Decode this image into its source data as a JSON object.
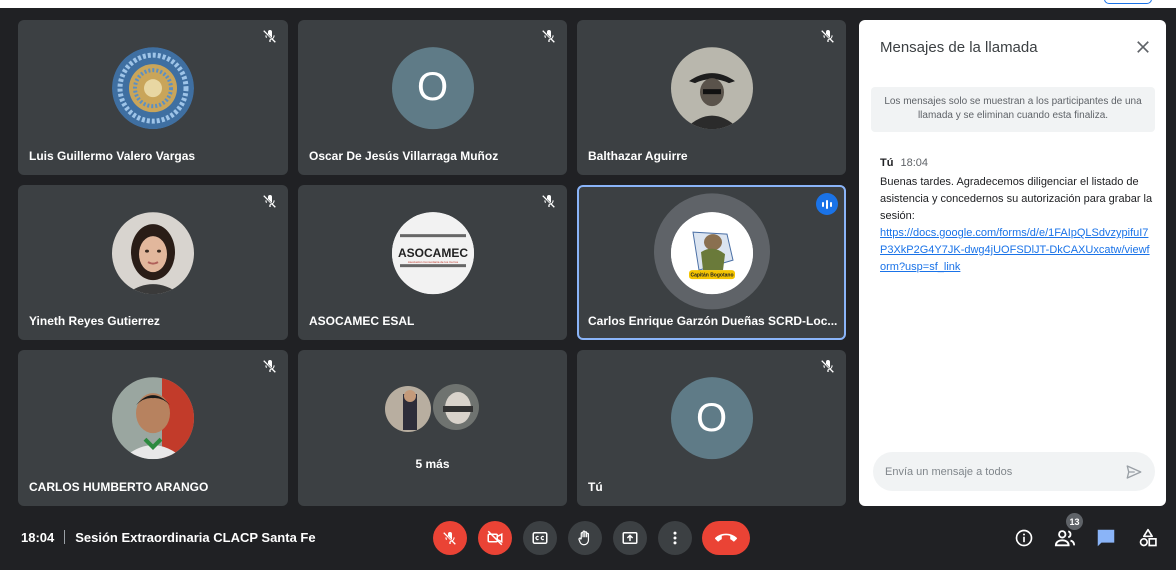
{
  "participants": [
    {
      "name": "Luis Guillermo Valero Vargas",
      "avatar": "photo-mandala",
      "muted": true
    },
    {
      "name": "Oscar De Jesús Villarraga Muñoz",
      "avatar_letter": "O",
      "muted": true
    },
    {
      "name": "Balthazar Aguirre",
      "avatar": "photo-portrait-hat",
      "muted": true
    },
    {
      "name": "Yineth Reyes Gutierrez",
      "avatar": "photo-woman",
      "muted": true
    },
    {
      "name": "ASOCAMEC ESAL",
      "avatar_logo_text": "ASOCAMEC",
      "avatar_logo_subtext": "Asociación Comunitaria de los Cerros",
      "muted": true
    },
    {
      "name": "Carlos Enrique Garzón Dueñas SCRD-Loc...",
      "avatar": "logo-capitan-bogotano",
      "avatar_logo_text": "Capitán Bogotano",
      "muted": false,
      "speaking": true
    },
    {
      "name": "CARLOS HUMBERTO ARANGO",
      "avatar": "photo-man",
      "muted": true
    },
    {
      "more_label": "5 más"
    },
    {
      "name": "Tú",
      "avatar_letter": "O",
      "muted": true
    }
  ],
  "chat": {
    "title": "Mensajes de la llamada",
    "notice": "Los mensajes solo se muestran a los participantes de una llamada y se eliminan cuando esta finaliza.",
    "message": {
      "sender": "Tú",
      "time": "18:04",
      "text": "Buenas tardes. Agradecemos diligenciar el listado de asistencia y concedernos su autorización para grabar la sesión:",
      "link": "https://docs.google.com/forms/d/e/1FAIpQLSdvzypifuI7P3XkP2G4Y7JK-dwg4jUOFSDlJT-DkCAXUxcatw/viewform?usp=sf_link"
    },
    "input_placeholder": "Envía un mensaje a todos"
  },
  "meeting": {
    "time": "18:04",
    "title": "Sesión Extraordinaria CLACP Santa Fe"
  },
  "controls": [
    "mic-off-icon",
    "camera-off-icon",
    "captions-icon",
    "raise-hand-icon",
    "present-icon",
    "more-options-icon",
    "end-call-icon"
  ],
  "right_controls": {
    "people_count": "13",
    "icons": [
      "info-icon",
      "people-icon",
      "chat-icon",
      "activities-icon"
    ]
  },
  "colors": {
    "end_call": "#ea4335",
    "speaking": "#1a73e8",
    "tile": "#3c4043",
    "link": "#1a73e8"
  }
}
